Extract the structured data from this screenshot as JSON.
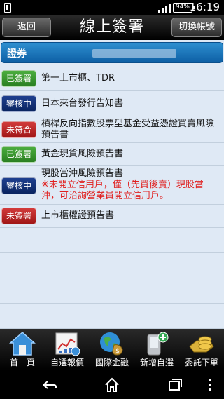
{
  "status": {
    "battery": "94%",
    "time": "16:19"
  },
  "header": {
    "back_label": "返回",
    "title": "線上簽署",
    "switch_label": "切換帳號"
  },
  "account": {
    "label": "證券",
    "value": ""
  },
  "items": [
    {
      "status": "已簽署",
      "text": "第一上市櫃、TDR",
      "note": ""
    },
    {
      "status": "審核中",
      "text": "日本來台發行告知書",
      "note": ""
    },
    {
      "status": "未符合",
      "text": "槓桿反向指數股票型基金受益憑證買賣風險預告書",
      "note": ""
    },
    {
      "status": "已簽署",
      "text": "黃金現貨風險預告書",
      "note": ""
    },
    {
      "status": "審核中",
      "text": "現股當沖風險預告書",
      "note": "※未開立信用戶，僅（先買後賣）現股當沖，可洽詢營業員開立信用戶。"
    },
    {
      "status": "未簽署",
      "text": "上市櫃權證預告書",
      "note": ""
    }
  ],
  "tabs": [
    {
      "label": "首　頁",
      "icon": "home-icon"
    },
    {
      "label": "自選報價",
      "icon": "quote-chart-icon"
    },
    {
      "label": "國際金融",
      "icon": "globe-money-icon"
    },
    {
      "label": "新增自選",
      "icon": "phone-add-icon"
    },
    {
      "label": "委託下單",
      "icon": "gold-coins-icon"
    }
  ],
  "colors": {
    "signed": "#3a9a30",
    "review": "#14327a",
    "not_met": "#c02a2a",
    "accent": "#1a74bf"
  }
}
